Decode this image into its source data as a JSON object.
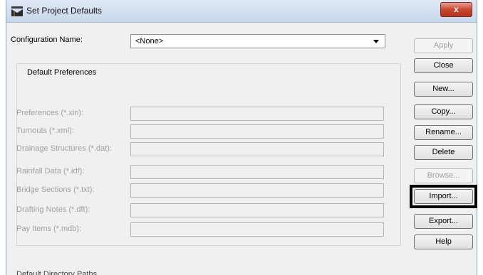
{
  "window": {
    "title": "Set Project Defaults",
    "close_symbol": "x"
  },
  "config": {
    "label": "Configuration Name:",
    "value": "<None>"
  },
  "group": {
    "title": "Default Preferences"
  },
  "fields": [
    {
      "label": "Preferences (*.xin):",
      "value": ""
    },
    {
      "label": "Turnouts (*.xml):",
      "value": ""
    },
    {
      "label": "Drainage Structures (*.dat):",
      "value": ""
    },
    {
      "label": "Rainfall Data (*.idf):",
      "value": ""
    },
    {
      "label": "Bridge Sections (*.txt):",
      "value": ""
    },
    {
      "label": "Drafting Notes (*.dft):",
      "value": ""
    },
    {
      "label": "Pay Items (*.mdb):",
      "value": ""
    }
  ],
  "buttons": {
    "apply": "Apply",
    "close": "Close",
    "new": "New...",
    "copy": "Copy...",
    "rename": "Rename...",
    "delete": "Delete",
    "browse": "Browse...",
    "import": "Import...",
    "export": "Export...",
    "help": "Help"
  },
  "footer": {
    "cut_label": "Default Directory Paths"
  }
}
